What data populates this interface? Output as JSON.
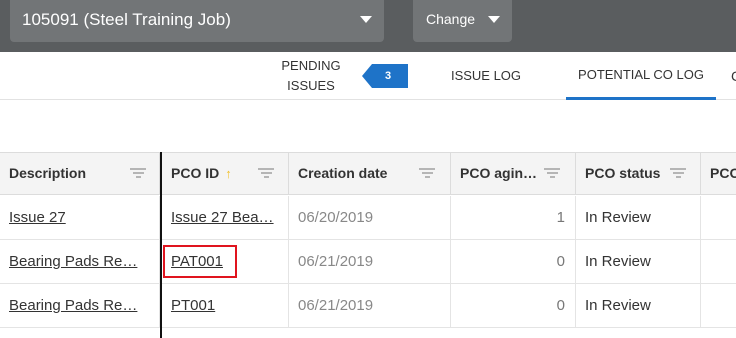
{
  "header": {
    "job_label": "105091 (Steel Training Job)",
    "change_label": "Change"
  },
  "tabs": {
    "pending_label": "PENDING ISSUES",
    "pending_badge": "3",
    "issue_log_label": "ISSUE LOG",
    "pco_log_label": "POTENTIAL CO LOG",
    "more_label": "C"
  },
  "table": {
    "columns": [
      "Description",
      "PCO ID",
      "Creation date",
      "PCO agin…",
      "PCO status",
      "PCO"
    ],
    "rows": [
      {
        "description": "Issue 27",
        "pco_id": "Issue 27 Bea…",
        "creation_date": "06/20/2019",
        "pco_aging": "1",
        "pco_status": "In Review"
      },
      {
        "description": "Bearing Pads Re…",
        "pco_id": "PAT001",
        "creation_date": "06/21/2019",
        "pco_aging": "0",
        "pco_status": "In Review"
      },
      {
        "description": "Bearing Pads Re…",
        "pco_id": "PT001",
        "creation_date": "06/21/2019",
        "pco_aging": "0",
        "pco_status": "In Review"
      }
    ]
  },
  "colors": {
    "accent": "#1e73c8",
    "topbar": "#5a5d5f",
    "highlight": "#e0141e"
  }
}
